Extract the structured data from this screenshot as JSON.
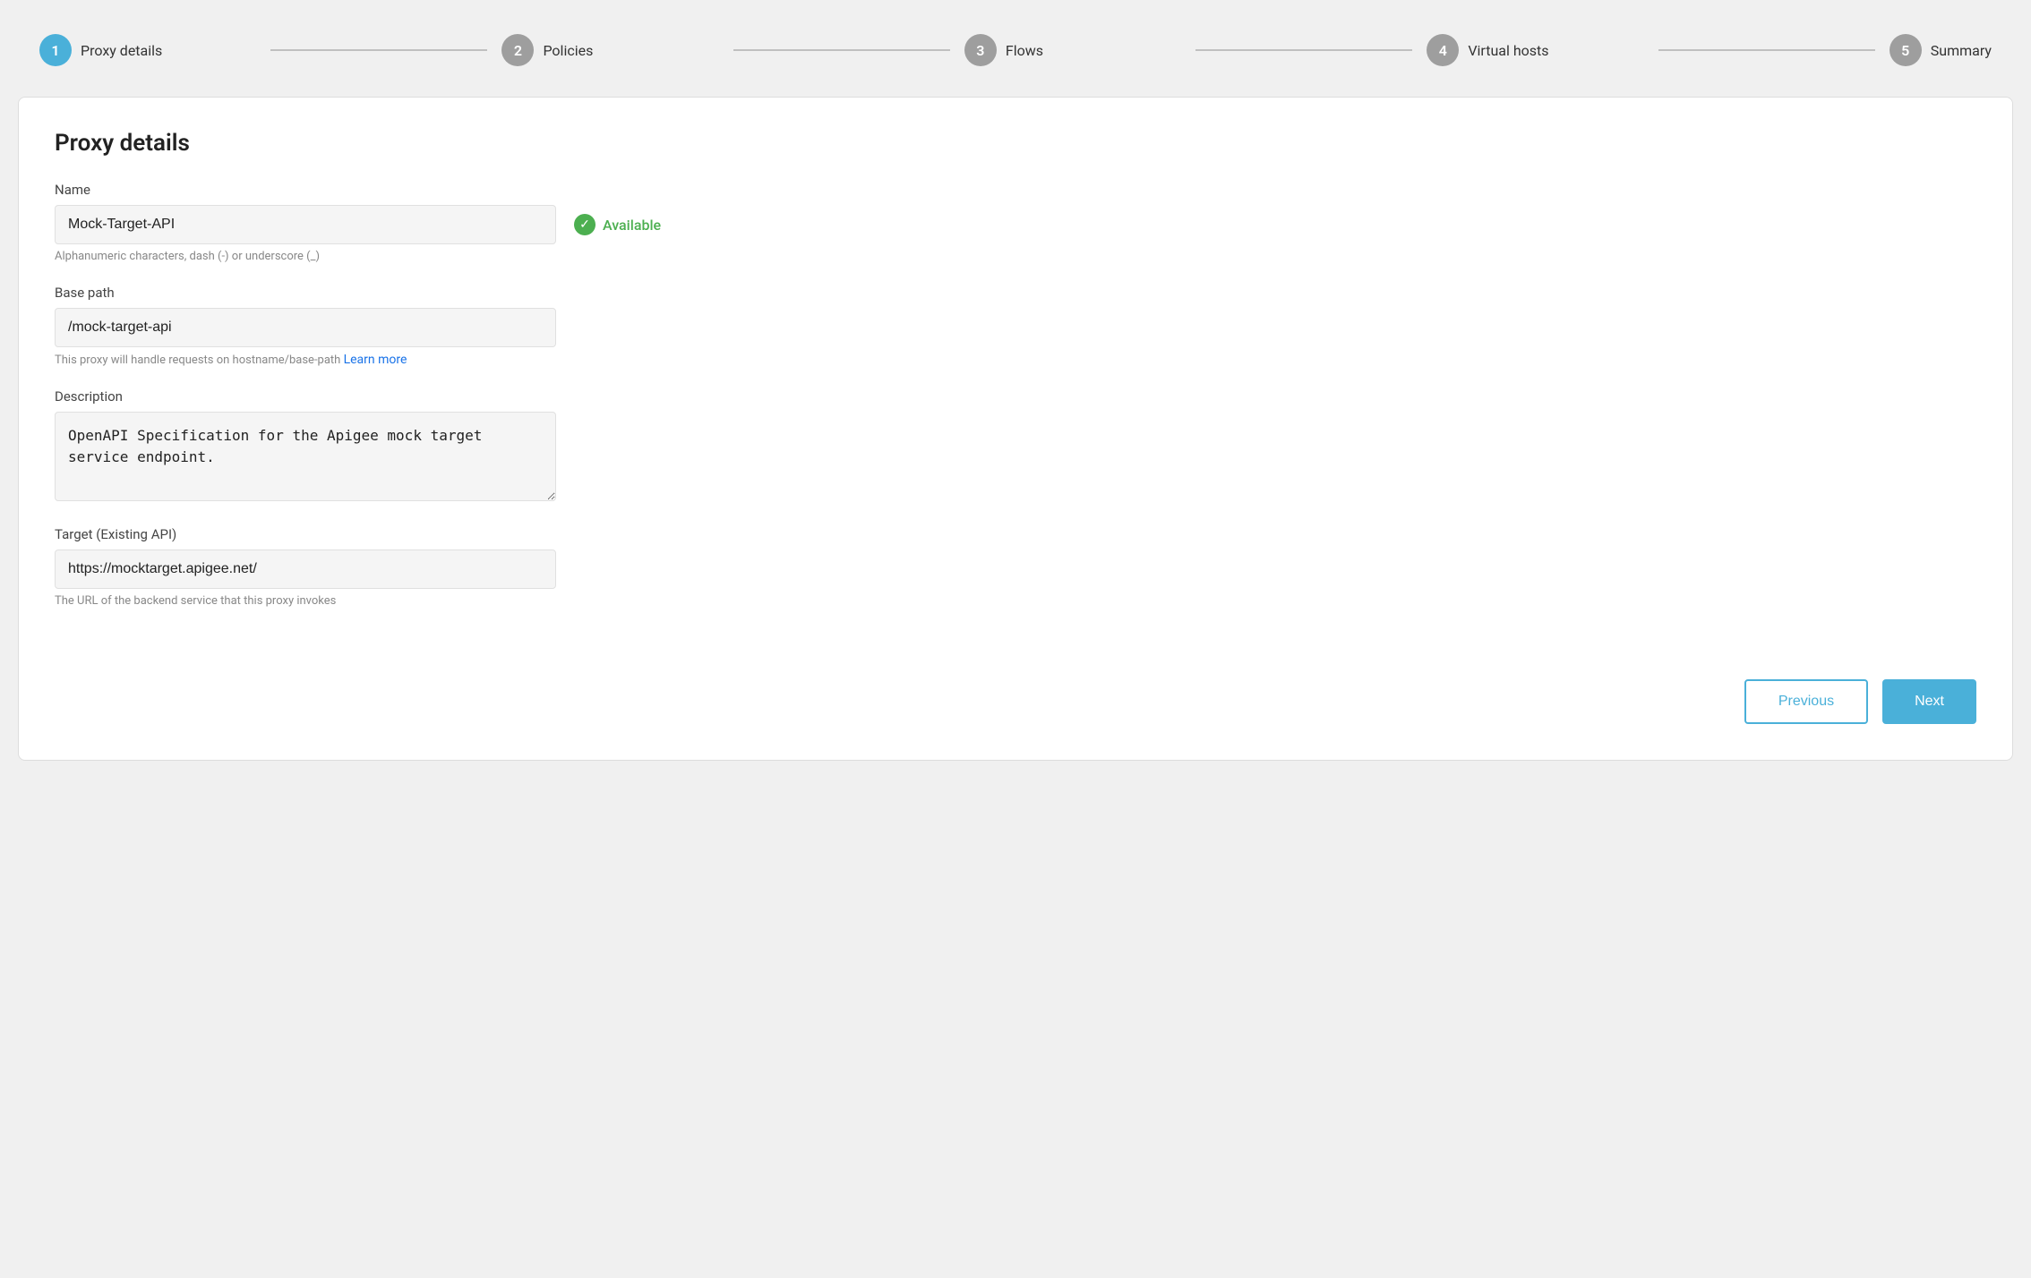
{
  "stepper": {
    "steps": [
      {
        "number": "1",
        "label": "Proxy details",
        "state": "active"
      },
      {
        "number": "2",
        "label": "Policies",
        "state": "inactive"
      },
      {
        "number": "3",
        "label": "Flows",
        "state": "inactive"
      },
      {
        "number": "4",
        "label": "Virtual hosts",
        "state": "inactive"
      },
      {
        "number": "5",
        "label": "Summary",
        "state": "inactive"
      }
    ]
  },
  "form": {
    "title": "Proxy details",
    "name_label": "Name",
    "name_value": "Mock-Target-API",
    "name_hint": "Alphanumeric characters, dash (-) or underscore (_)",
    "available_label": "Available",
    "base_path_label": "Base path",
    "base_path_value": "/mock-target-api",
    "base_path_hint": "This proxy will handle requests on hostname/base-path",
    "learn_more_label": "Learn more",
    "description_label": "Description",
    "description_value": "OpenAPI Specification for the Apigee mock target service endpoint.",
    "target_label": "Target (Existing API)",
    "target_value": "https://mocktarget.apigee.net/",
    "target_hint": "The URL of the backend service that this proxy invokes"
  },
  "footer": {
    "previous_label": "Previous",
    "next_label": "Next"
  },
  "colors": {
    "active_step": "#4ab0d9",
    "inactive_step": "#9e9e9e",
    "available_green": "#4caf50",
    "link_blue": "#1a73e8",
    "next_btn": "#4ab0d9"
  }
}
